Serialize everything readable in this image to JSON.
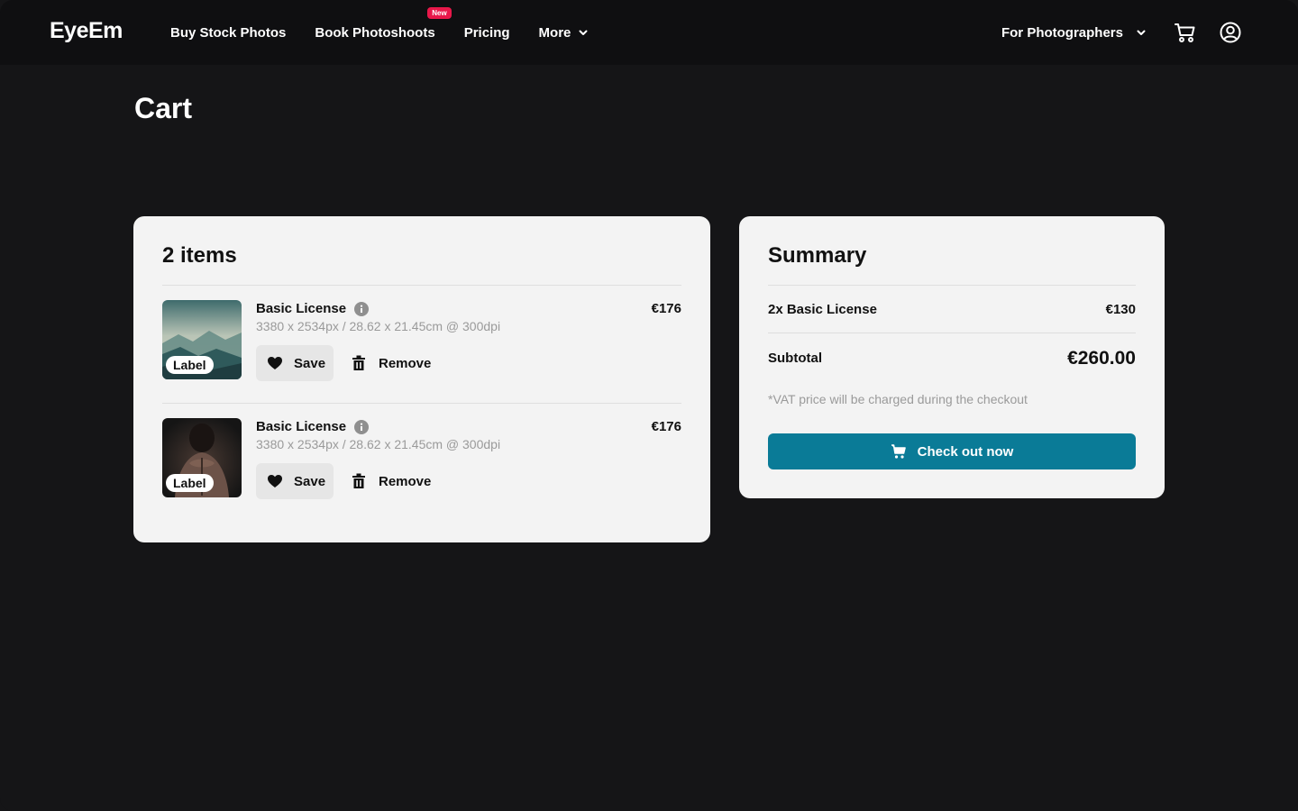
{
  "brand": {
    "logo": "EyeEm"
  },
  "nav": {
    "items": [
      {
        "label": "Buy Stock Photos"
      },
      {
        "label": "Book Photoshoots",
        "badge": "New"
      },
      {
        "label": "Pricing"
      },
      {
        "label": "More"
      }
    ],
    "right": {
      "label": "For Photographers"
    }
  },
  "page": {
    "title": "Cart"
  },
  "items_card": {
    "title": "2 items",
    "items": [
      {
        "name": "Basic License",
        "dims": "3380 x 2534px / 28.62 x 21.45cm @ 300dpi",
        "price": "€176",
        "thumb_label": "Label",
        "save_label": "Save",
        "remove_label": "Remove"
      },
      {
        "name": "Basic License",
        "dims": "3380 x 2534px / 28.62 x 21.45cm @ 300dpi",
        "price": "€176",
        "thumb_label": "Label",
        "save_label": "Save",
        "remove_label": "Remove"
      }
    ]
  },
  "summary": {
    "title": "Summary",
    "line_label": "2x Basic License",
    "line_value": "€130",
    "subtotal_label": "Subtotal",
    "subtotal_value": "€260.00",
    "vat_note": "*VAT price will be charged during the checkout",
    "checkout_label": "Check out now"
  },
  "colors": {
    "background": "#151517",
    "header": "#0f0f11",
    "card": "#f3f3f3",
    "accent": "#0a7b97",
    "badge": "#e8184a"
  }
}
